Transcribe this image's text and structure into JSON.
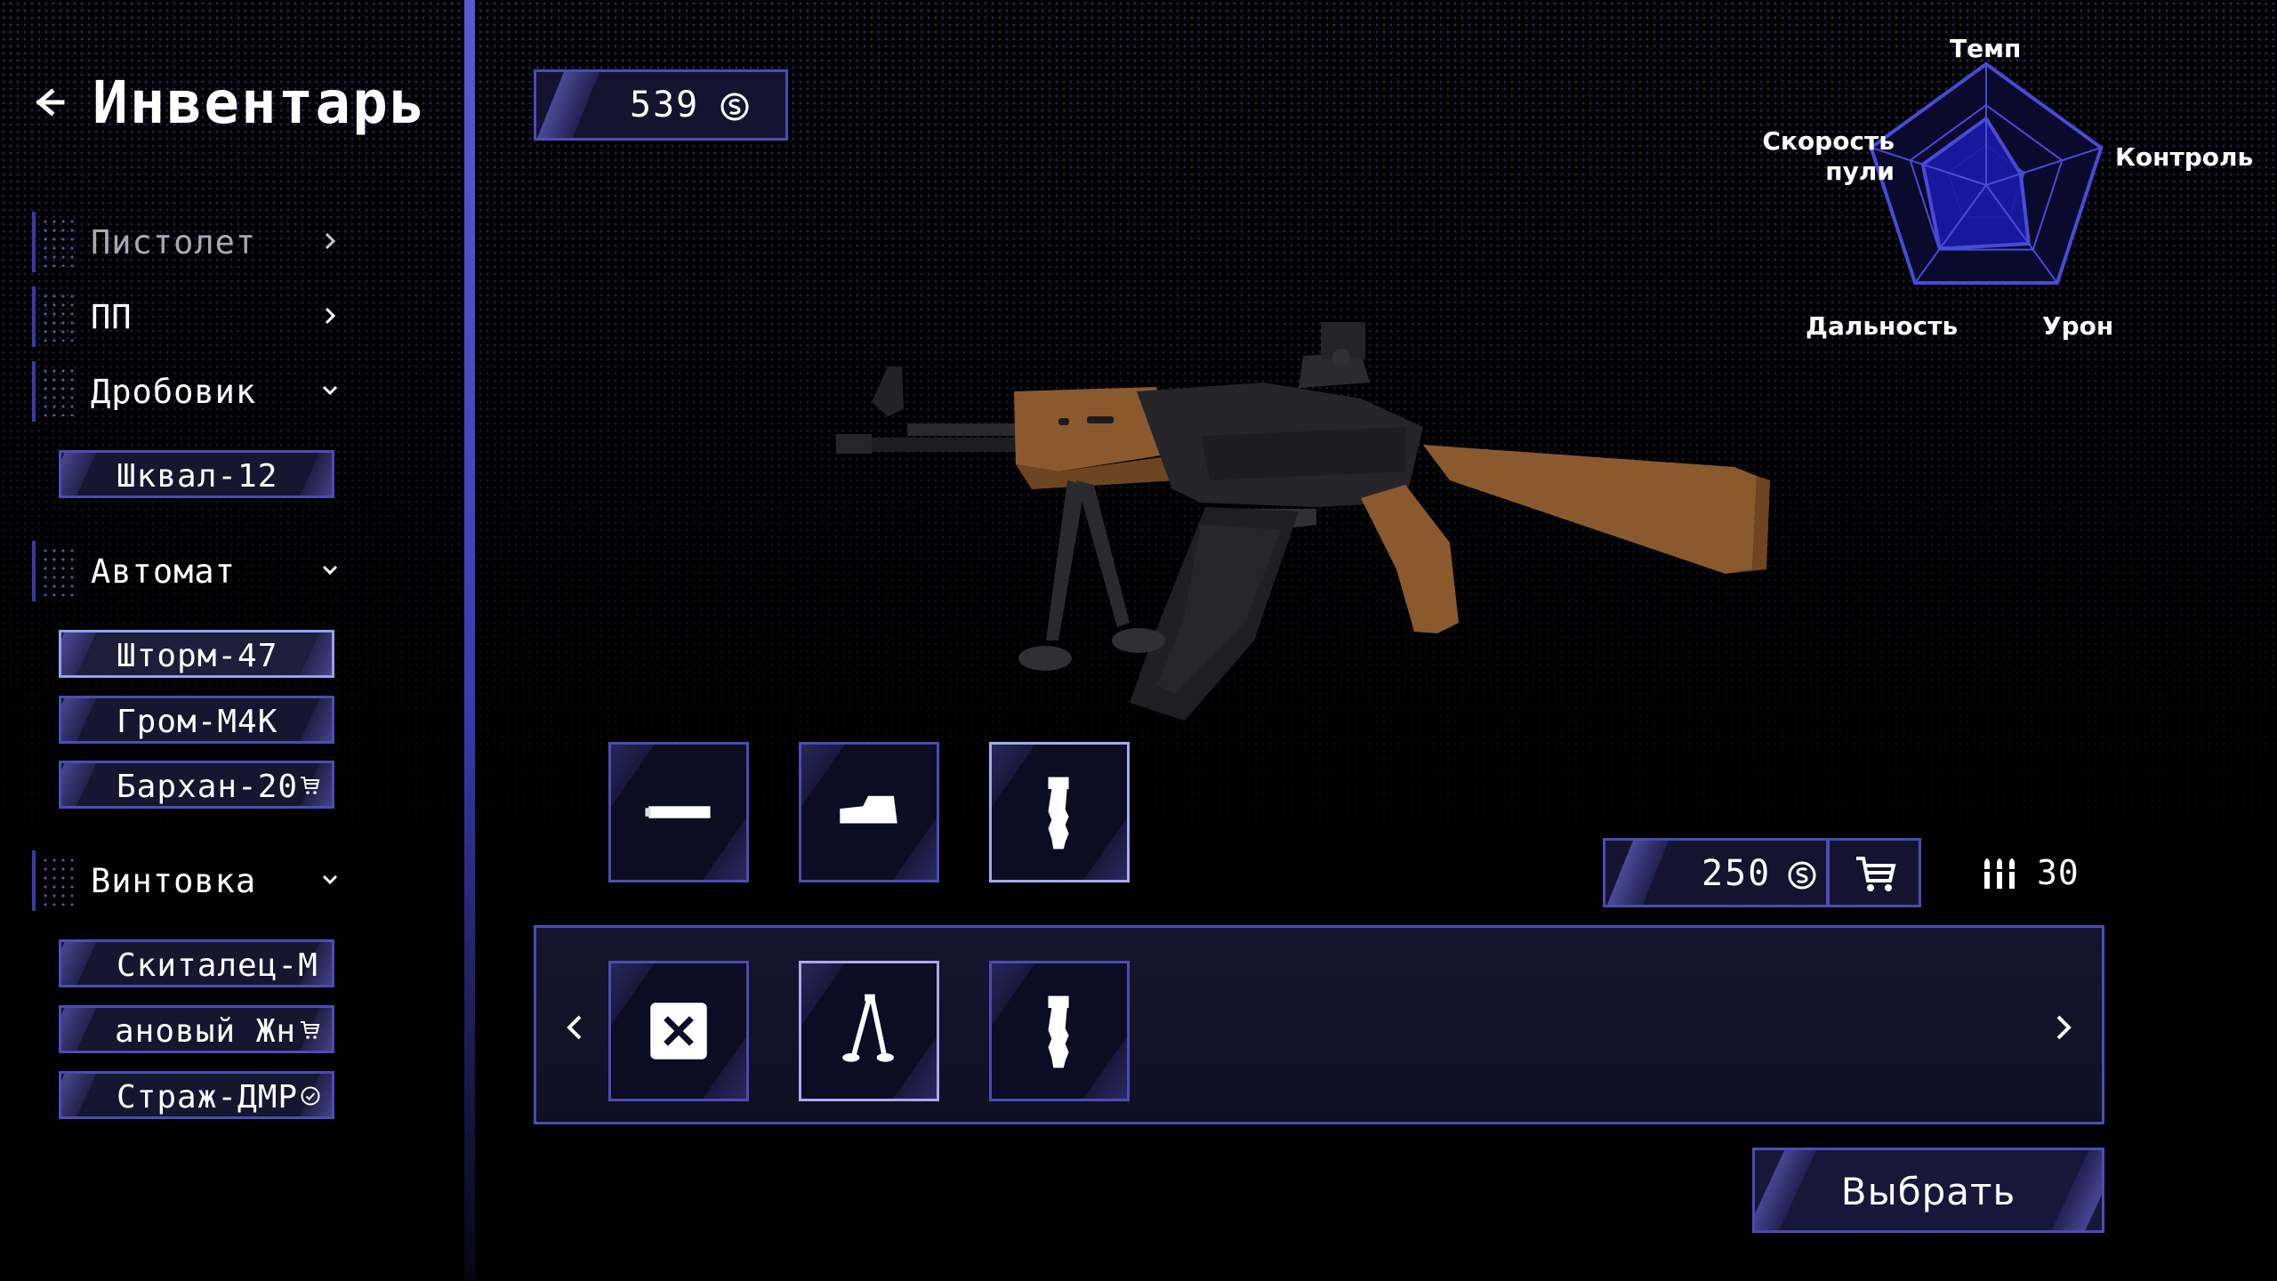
{
  "header": {
    "title": "Инвентарь"
  },
  "currency": {
    "balance": "539"
  },
  "categories": [
    {
      "label": "Пистолет",
      "state": "collapsed"
    },
    {
      "label": "ПП",
      "state": "collapsed"
    },
    {
      "label": "Дробовик",
      "state": "expanded"
    },
    {
      "label": "Автомат",
      "state": "expanded"
    },
    {
      "label": "Винтовка",
      "state": "expanded"
    }
  ],
  "weapons": {
    "shotgun": [
      {
        "label": "Шквал-12",
        "status": ""
      }
    ],
    "rifle": [
      {
        "label": "Шторм-47",
        "status": "selected"
      },
      {
        "label": "Гром-М4К",
        "status": ""
      },
      {
        "label": "Бархан-20",
        "status": "cart-icon"
      }
    ],
    "sniper": [
      {
        "label": "Скиталец-М",
        "status": ""
      },
      {
        "label": "ановый Жн",
        "status": "cart-icon"
      },
      {
        "label": "Страж-ДМР",
        "status": "check-icon"
      }
    ]
  },
  "radar": {
    "labels": {
      "top": "Темп",
      "right": "Контроль",
      "bottom_right": "Урон",
      "bottom_left": "Дальность",
      "left_line1": "Скорость",
      "left_line2": "пули"
    },
    "values": {
      "temp": 0.55,
      "control": 0.3,
      "damage": 0.6,
      "range": 0.65,
      "bullet_speed": 0.55
    },
    "colors": {
      "outline": "#4a4ad8",
      "fill": "#1a1aa8"
    }
  },
  "attachment_slots": [
    {
      "icon": "muzzle-icon",
      "selected": false
    },
    {
      "icon": "sight-icon",
      "selected": false
    },
    {
      "icon": "grip-icon",
      "selected": true
    }
  ],
  "shop": {
    "price": "250",
    "ammo": "30"
  },
  "carousel": {
    "items": [
      {
        "icon": "remove-icon",
        "selected": false
      },
      {
        "icon": "bipod-icon",
        "selected": true
      },
      {
        "icon": "grip-icon",
        "selected": false
      }
    ]
  },
  "actions": {
    "select_label": "Выбрать"
  },
  "colors": {
    "accent": "#4c4cb4",
    "accent_light": "#a8a8f0",
    "panel": "#141430",
    "wood": "#8a5a2e",
    "metal": "#222226"
  }
}
